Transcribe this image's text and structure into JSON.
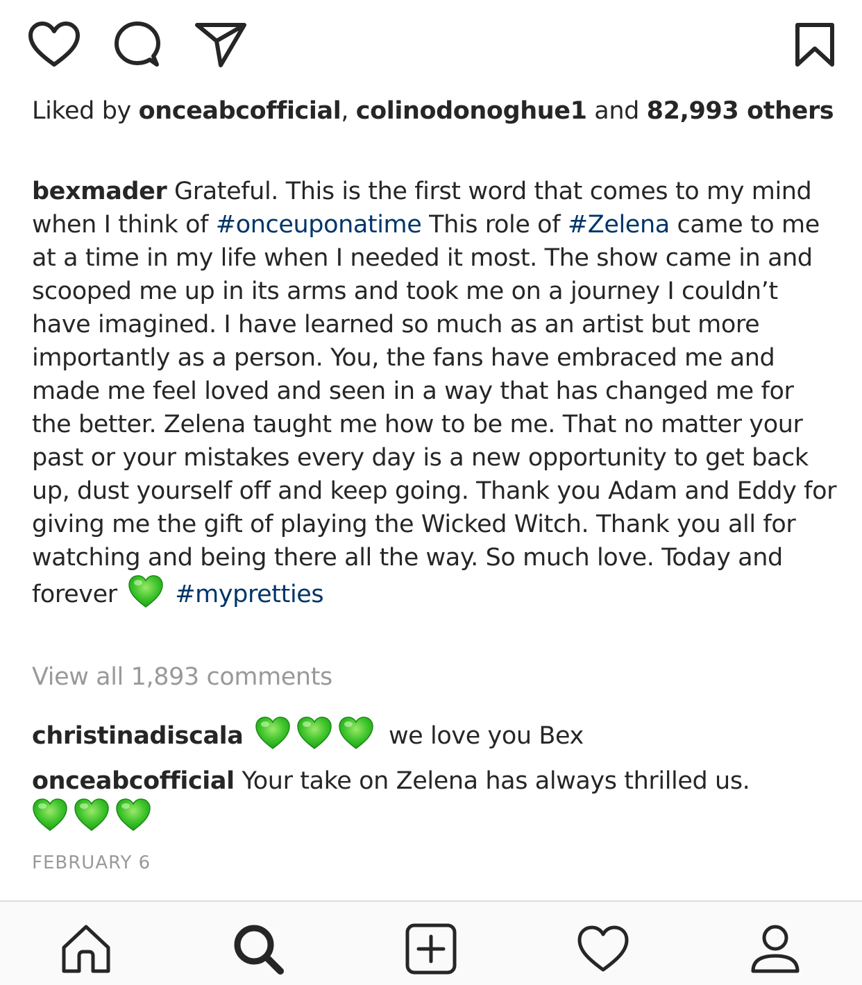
{
  "post": {
    "likes": {
      "prefix": "Liked by ",
      "user1": "onceabcofficial",
      "sep": ", ",
      "user2": "colinodonoghue1",
      "mid": " and ",
      "count": "82,993 others"
    },
    "caption": {
      "username": "bexmader",
      "text1": " Grateful. This is the first word that comes to my mind when I think of ",
      "tag1": "#onceuponatime",
      "text2": " This role of ",
      "tag2": "#Zelena",
      "text3": " came to me at a time in my life when I needed it most. The show came in and scooped me up in its arms and took me on a journey I couldn’t have imagined. I have learned so much as an artist but more importantly as a person. You, the fans have embraced me and made me feel loved and seen in a way that has changed me for the better. Zelena taught me how to be me. That no matter your past or your mistakes every day is a new opportunity to get back up, dust yourself off and keep going. Thank you Adam and Eddy for giving me the gift of playing the Wicked Witch. Thank you all for watching and being there all the way. So much love. Today and forever",
      "tag3": "#mypretties"
    },
    "view_all": "View all 1,893 comments",
    "comments": [
      {
        "username": "christinadiscala",
        "text": "we love you Bex"
      },
      {
        "username": "onceabcofficial",
        "text": " Your take on Zelena has always thrilled us."
      }
    ],
    "date": "FEBRUARY 6"
  },
  "icons": {
    "like": "heart-outline-icon",
    "comment": "speech-bubble-icon",
    "share": "paper-plane-icon",
    "save": "bookmark-icon",
    "emoji": "green-heart-emoji"
  },
  "tabbar": [
    "home-icon",
    "search-icon",
    "add-post-icon",
    "activity-heart-icon",
    "profile-icon"
  ],
  "colors": {
    "text": "#262626",
    "hashtag": "#003569",
    "muted": "#999999",
    "emoji_heart": "#4cd137"
  }
}
